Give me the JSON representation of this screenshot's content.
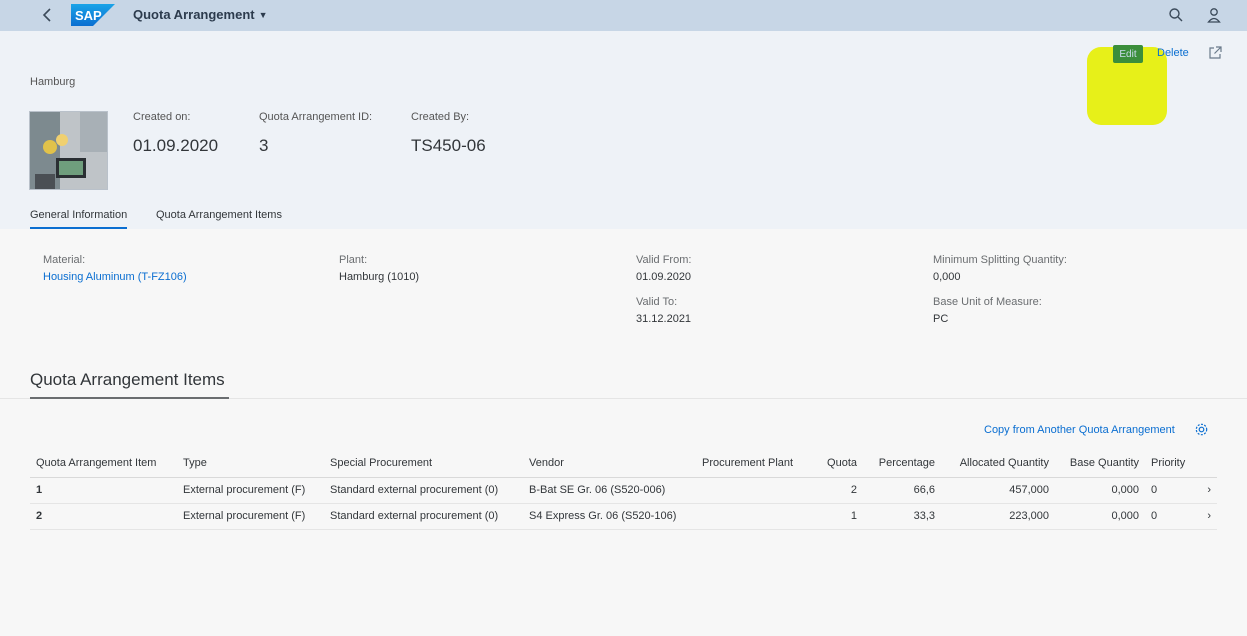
{
  "shell": {
    "title": "Quota Arrangement",
    "logo_text": "SAP",
    "icons": [
      "back-icon",
      "search-icon",
      "user-icon"
    ]
  },
  "header": {
    "breadcrumb": "Hamburg",
    "fields": [
      {
        "label": "Created on:",
        "value": "01.09.2020"
      },
      {
        "label": "Quota Arrangement ID:",
        "value": "3"
      },
      {
        "label": "Created By:",
        "value": "TS450-06"
      }
    ],
    "actions": {
      "edit": "Edit",
      "delete": "Delete"
    },
    "tabs": [
      "General Information",
      "Quota Arrangement Items"
    ]
  },
  "general": {
    "material_label": "Material:",
    "material_value": "Housing Aluminum (T-FZ106)",
    "plant_label": "Plant:",
    "plant_value": "Hamburg (1010)",
    "valid_from_label": "Valid From:",
    "valid_from_value": "01.09.2020",
    "valid_to_label": "Valid To:",
    "valid_to_value": "31.12.2021",
    "min_split_label": "Minimum Splitting Quantity:",
    "min_split_value": "0,000",
    "base_uom_label": "Base Unit of Measure:",
    "base_uom_value": "PC"
  },
  "items": {
    "title": "Quota Arrangement Items",
    "copy_link": "Copy from Another Quota Arrangement",
    "columns": [
      "Quota Arrangement Item",
      "Type",
      "Special Procurement",
      "Vendor",
      "Procurement Plant",
      "Quota",
      "Percentage",
      "Allocated Quantity",
      "Base Quantity",
      "Priority"
    ],
    "rows": [
      {
        "item": "1",
        "type": "External procurement (F)",
        "special": "Standard external procurement (0)",
        "vendor": "B-Bat SE Gr. 06 (S520-006)",
        "plant": "",
        "quota": "2",
        "percentage": "66,6",
        "allocated": "457,000",
        "base": "0,000",
        "priority": "0"
      },
      {
        "item": "2",
        "type": "External procurement (F)",
        "special": "Standard external procurement (0)",
        "vendor": "S4 Express Gr. 06 (S520-106)",
        "plant": "",
        "quota": "1",
        "percentage": "33,3",
        "allocated": "223,000",
        "base": "0,000",
        "priority": "0"
      }
    ]
  },
  "colors": {
    "shell": "#c7d6e6",
    "link": "#0a6ed1",
    "edit": "#3b8e3b",
    "highlight": "#e6f000"
  }
}
